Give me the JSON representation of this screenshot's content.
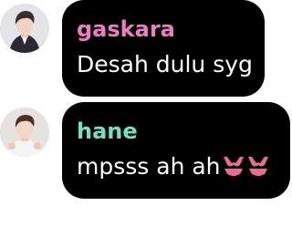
{
  "messages": [
    {
      "sender": "gaskara",
      "text": "Desah dulu syg",
      "sender_color": "#f07ac4",
      "emoji": []
    },
    {
      "sender": "hane",
      "text": "mpsss ah ah",
      "sender_color": "#6ee2c4",
      "emoji": [
        "bikini-emoji",
        "bikini-emoji"
      ]
    }
  ],
  "colors": {
    "bubble": "#000000",
    "message_text": "#ffffff",
    "emoji": "#ec6b93"
  }
}
